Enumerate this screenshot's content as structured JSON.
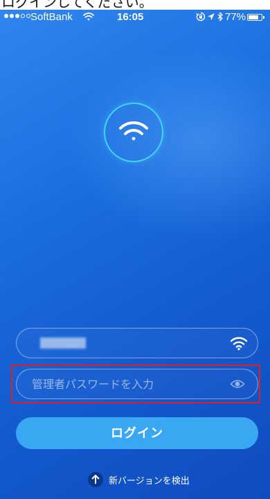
{
  "caption": {
    "text": "ログインしてください。"
  },
  "status_bar": {
    "signal_dots": [
      true,
      true,
      true,
      false,
      false
    ],
    "carrier": "SoftBank",
    "time": "16:05",
    "battery_percent": "77%",
    "battery_level": 0.77
  },
  "login_form": {
    "ssid_value": "■■ ■■",
    "password_placeholder": "管理者パスワードを入力",
    "login_label": "ログイン"
  },
  "footer": {
    "check_update_label": "新バージョンを検出"
  },
  "colors": {
    "background_top": "#2f86f0",
    "background_bottom": "#0f4cbf",
    "logo_ring": "#42d6ff",
    "login_button": "#3aa7f3",
    "highlight_box": "#e02020"
  },
  "icons": {
    "status_wifi": "wifi-icon",
    "orientation_lock": "orientation-lock-icon",
    "location": "location-arrow-icon",
    "bluetooth": "bluetooth-icon",
    "logo": "wifi-logo-icon",
    "ssid": "wifi-icon",
    "password_visibility": "eye-icon",
    "update": "arrow-up-icon"
  }
}
